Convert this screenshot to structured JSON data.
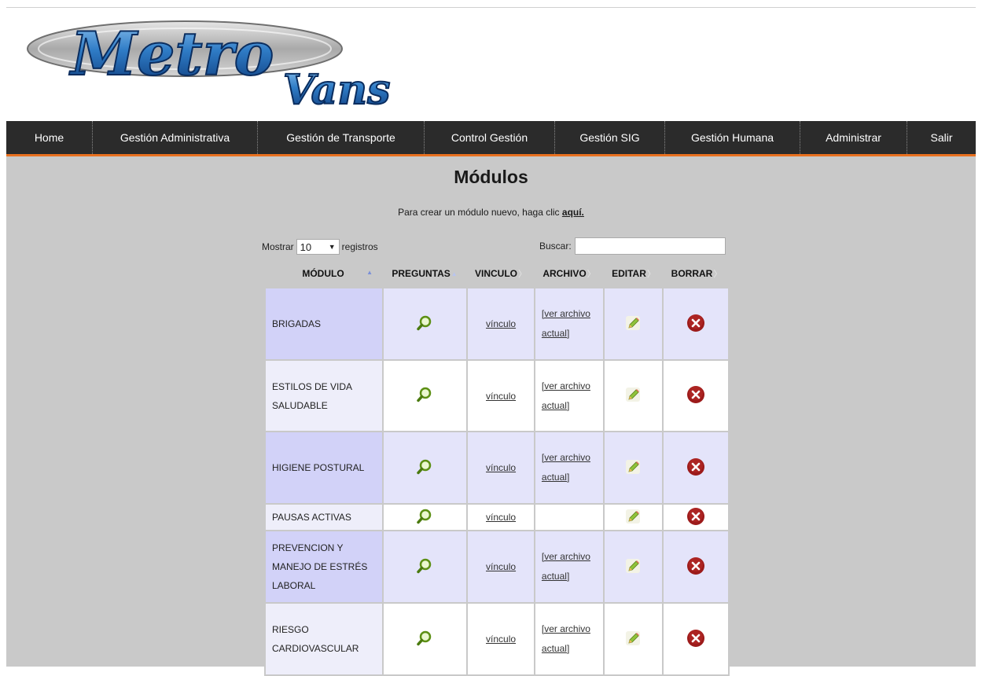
{
  "logo": {
    "alt": "Metro Vans",
    "line1": "Metro",
    "line2": "Vans"
  },
  "nav": [
    {
      "label": "Home"
    },
    {
      "label": "Gestión Administrativa"
    },
    {
      "label": "Gestión de Transporte"
    },
    {
      "label": "Control Gestión"
    },
    {
      "label": "Gestión SIG"
    },
    {
      "label": "Gestión Humana"
    },
    {
      "label": "Administrar"
    },
    {
      "label": "Salir"
    }
  ],
  "page": {
    "title": "Módulos",
    "create_text": "Para crear un módulo nuevo, haga clic ",
    "create_link": "aquí."
  },
  "controls": {
    "show_label": "Mostrar",
    "show_value": "10",
    "records_label": "registros",
    "search_label": "Buscar:",
    "search_value": ""
  },
  "table": {
    "headers": [
      "MÓDULO",
      "PREGUNTAS",
      "VINCULO",
      "ARCHIVO",
      "EDITAR",
      "BORRAR"
    ],
    "rows": [
      {
        "module": "BRIGADAS",
        "link": "vínculo",
        "file": "[ver archivo actual]"
      },
      {
        "module": "ESTILOS DE VIDA SALUDABLE",
        "link": "vínculo",
        "file": "[ver archivo actual]"
      },
      {
        "module": "HIGIENE POSTURAL",
        "link": "vínculo",
        "file": "[ver archivo actual]"
      },
      {
        "module": "PAUSAS ACTIVAS",
        "link": "vínculo",
        "file": ""
      },
      {
        "module": "PREVENCION Y MANEJO DE ESTRÉS LABORAL",
        "link": "vínculo",
        "file": "[ver archivo actual]"
      },
      {
        "module": "RIESGO CARDIOVASCULAR",
        "link": "vínculo",
        "file": "[ver archivo actual]"
      }
    ]
  },
  "colors": {
    "nav_bg": "#2b2b2b",
    "nav_accent": "#e8701f",
    "content_bg": "#c9c9c9",
    "row_odd": "#e4e4fa",
    "row_odd_first": "#d2d2f8",
    "delete_icon": "#9c1a1a"
  },
  "icons": {
    "questions": "magnifier-icon",
    "edit": "pencil-icon",
    "delete": "delete-x-icon"
  }
}
